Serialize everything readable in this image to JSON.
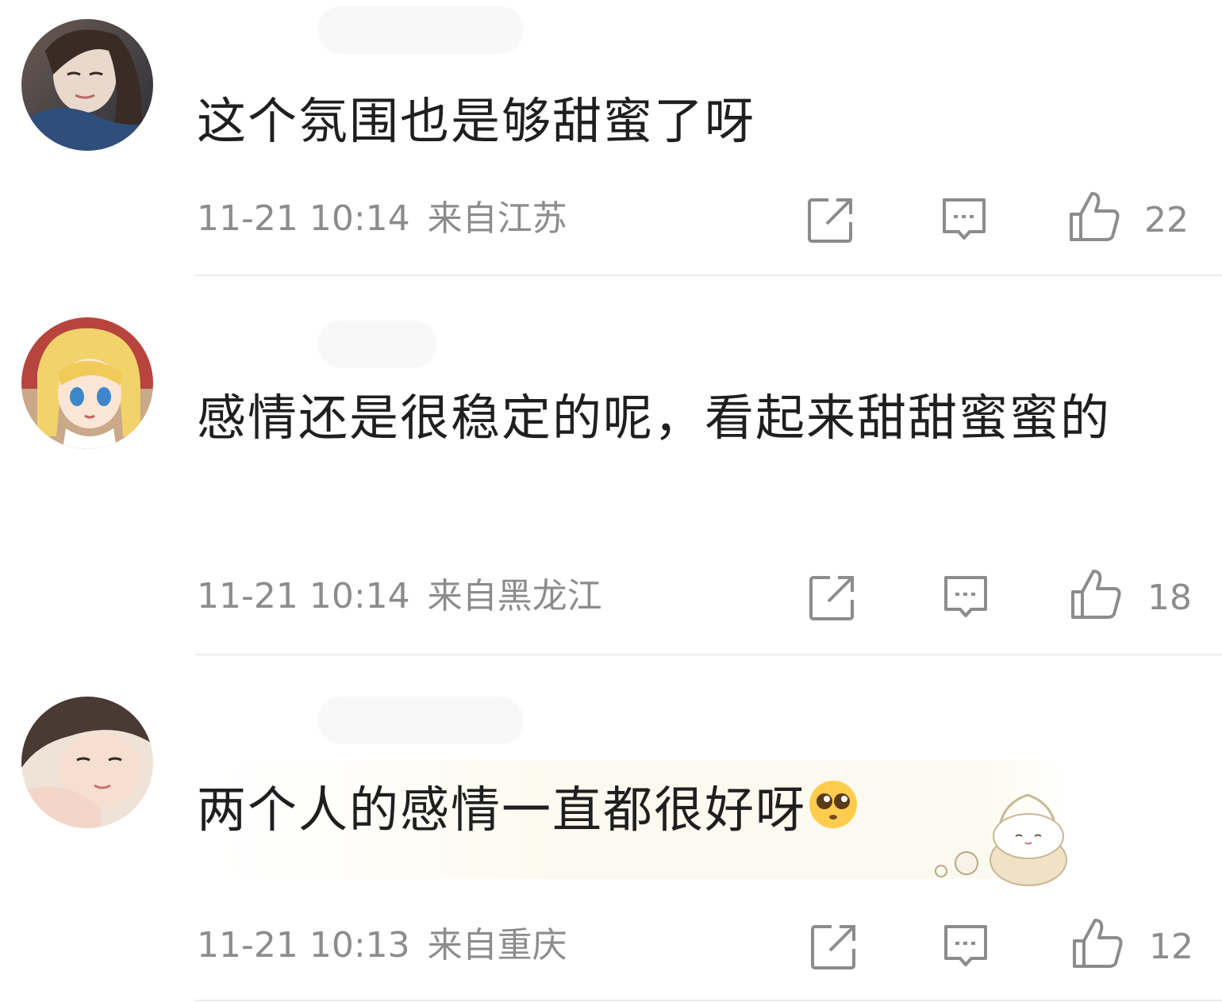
{
  "comments": [
    {
      "text": "这个氛围也是够甜蜜了呀",
      "time": "11-21 10:14",
      "location": "来自江苏",
      "likes": "22",
      "avatar": "woman-dark-hair-avatar"
    },
    {
      "text": "感情还是很稳定的呢，看起来甜甜蜜蜜的",
      "time": "11-21 10:14",
      "location": "来自黑龙江",
      "likes": "18",
      "avatar": "anime-blonde-girl-avatar"
    },
    {
      "text": "两个人的感情一直都很好呀",
      "time": "11-21 10:13",
      "location": "来自重庆",
      "likes": "12",
      "avatar": "woman-lying-avatar",
      "emoji": "pleading-face-emoji",
      "sticker": "cartoon-bunny-sticker"
    }
  ],
  "icons": {
    "share": "share-icon",
    "reply": "comment-icon",
    "like": "thumbs-up-icon"
  },
  "colors": {
    "text": "#1f1f1f",
    "meta": "#8c8c8c",
    "divider": "#ececec"
  }
}
